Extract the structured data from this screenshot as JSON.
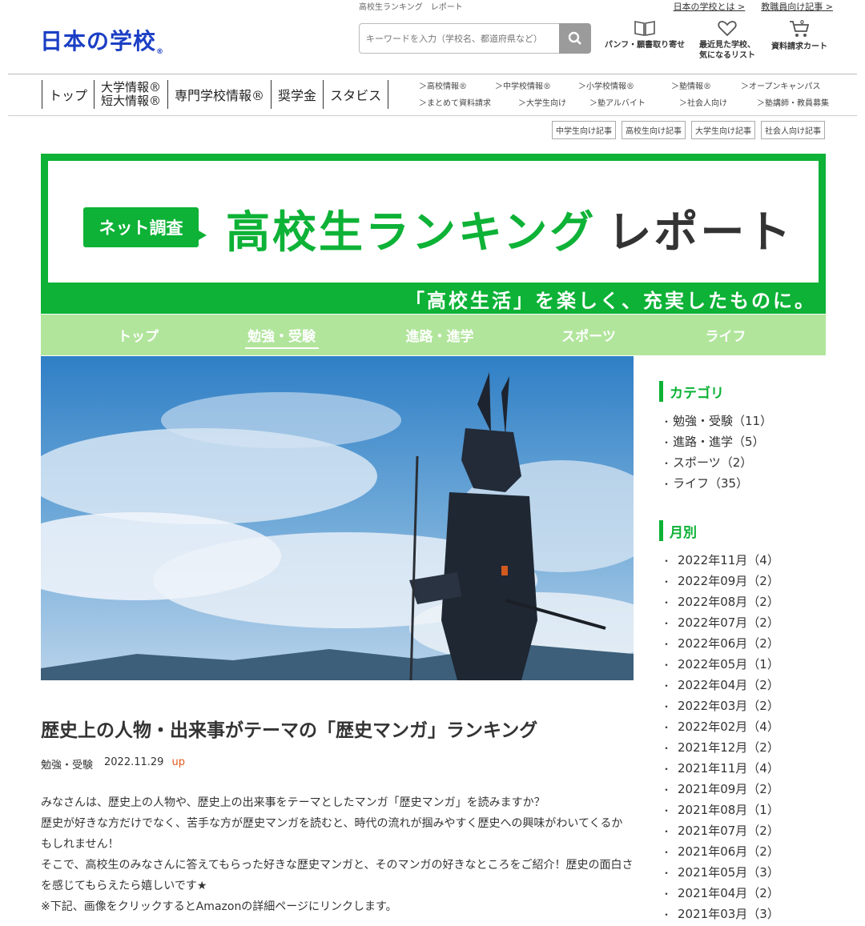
{
  "header": {
    "breadcrumb": "高校生ランキング　レポート",
    "top_links": [
      "日本の学校とは >",
      "教職員向け記事 >"
    ],
    "logo": "日本の学校",
    "search_placeholder": "キーワードを入力（学校名、都道府県など）",
    "quick_links": [
      {
        "label1": "パンフ・願書取り寄せ",
        "label2": "",
        "icon": "book-icon"
      },
      {
        "label1": "最近見た学校、",
        "label2": "気になるリスト",
        "icon": "heart-icon"
      },
      {
        "label1": "資料請求カート",
        "label2": "",
        "icon": "cart-icon"
      }
    ]
  },
  "gnav": {
    "top": "トップ",
    "univ1": "大学情報®",
    "univ2": "短大情報®",
    "senmon": "専門学校情報®",
    "shogakukin": "奨学金",
    "stabis": "スタビス",
    "sub_row1": [
      "＞高校情報®",
      "＞中学校情報®",
      "＞小学校情報®",
      "＞塾情報®",
      "＞オープンキャンパス"
    ],
    "sub_row2": [
      "＞まとめて資料請求",
      "＞大学生向け",
      "＞塾アルバイト",
      "＞社会人向け",
      "＞塾講師・教員募集"
    ]
  },
  "tags": [
    "中学生向け記事",
    "高校生向け記事",
    "大学生向け記事",
    "社会人向け記事"
  ],
  "banner": {
    "badge": "ネット調査",
    "title_green": "高校生ランキング",
    "title_dark": "レポート",
    "tagline": "「高校生活」を楽しく、充実したものに。"
  },
  "category_nav": [
    "トップ",
    "勉強・受験",
    "進路・進学",
    "スポーツ",
    "ライフ"
  ],
  "article": {
    "title": "歴史上の人物・出来事がテーマの「歴史マンガ」ランキング",
    "category": "勉強・受験",
    "date": "2022.11.29",
    "up": "up",
    "paragraphs": [
      "みなさんは、歴史上の人物や、歴史上の出来事をテーマとしたマンガ「歴史マンガ」を読みますか？",
      "歴史が好きな方だけでなく、苦手な方が歴史マンガを読むと、時代の流れが掴みやすく歴史への興味がわいてくるかもしれません！",
      "そこで、高校生のみなさんに答えてもらった好きな歴史マンガと、そのマンガの好きなところをご紹介！歴史の面白さを感じてもらえたら嬉しいです★",
      "※下記、画像をクリックするとAmazonの詳細ページにリンクします。"
    ]
  },
  "sidebar": {
    "category_heading": "カテゴリ",
    "categories": [
      "勉強・受験（11）",
      "進路・進学（5）",
      "スポーツ（2）",
      "ライフ（35）"
    ],
    "month_heading": "月別",
    "months": [
      "2022年11月（4）",
      "2022年09月（2）",
      "2022年08月（2）",
      "2022年07月（2）",
      "2022年06月（2）",
      "2022年05月（1）",
      "2022年04月（2）",
      "2022年03月（2）",
      "2022年02月（4）",
      "2021年12月（2）",
      "2021年11月（4）",
      "2021年09月（2）",
      "2021年08月（1）",
      "2021年07月（2）",
      "2021年06月（2）",
      "2021年05月（3）",
      "2021年04月（2）",
      "2021年03月（3）"
    ]
  },
  "colors": {
    "brand_green": "#0db236",
    "nav_light_green": "#b1e59c",
    "logo_blue": "#1b3fc4",
    "up_orange": "#e55a1e"
  }
}
